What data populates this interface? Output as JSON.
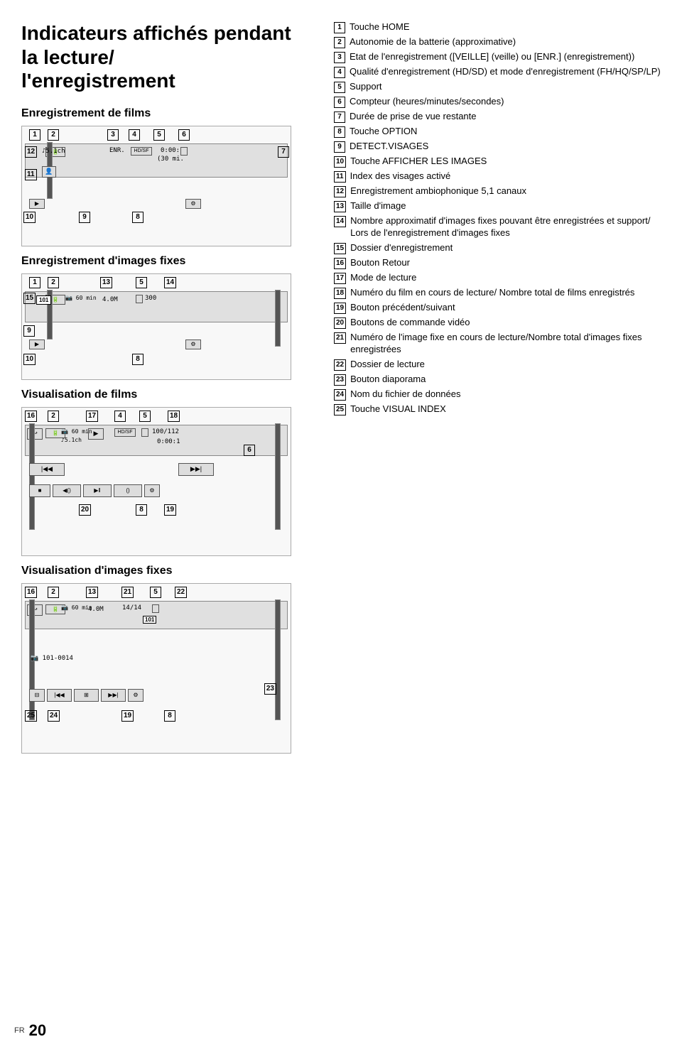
{
  "page": {
    "title_line1": "Indicateurs affichés pendant la lecture/",
    "title_line2": "l'enregistrement",
    "footer_lang": "FR",
    "footer_page": "20"
  },
  "sections": {
    "enregistrement_films": "Enregistrement de films",
    "enregistrement_images": "Enregistrement d'images fixes",
    "visualisation_films": "Visualisation de films",
    "visualisation_images": "Visualisation d'images fixes"
  },
  "items": [
    {
      "num": "1",
      "text": "Touche HOME"
    },
    {
      "num": "2",
      "text": "Autonomie de la batterie (approximative)"
    },
    {
      "num": "3",
      "text": "Etat de l'enregistrement ([VEILLE] (veille) ou [ENR.] (enregistrement))"
    },
    {
      "num": "4",
      "text": "Qualité d'enregistrement (HD/SD) et mode d'enregistrement (FH/HQ/SP/LP)"
    },
    {
      "num": "5",
      "text": "Support"
    },
    {
      "num": "6",
      "text": "Compteur (heures/minutes/secondes)"
    },
    {
      "num": "7",
      "text": "Durée de prise de vue restante"
    },
    {
      "num": "8",
      "text": "Touche OPTION"
    },
    {
      "num": "9",
      "text": "DETECT.VISAGES"
    },
    {
      "num": "10",
      "text": "Touche AFFICHER LES IMAGES"
    },
    {
      "num": "11",
      "text": "Index des visages activé"
    },
    {
      "num": "12",
      "text": "Enregistrement ambiophonique 5,1 canaux"
    },
    {
      "num": "13",
      "text": "Taille d'image"
    },
    {
      "num": "14",
      "text": "Nombre approximatif d'images fixes pouvant être enregistrées et support/ Lors de l'enregistrement d'images fixes"
    },
    {
      "num": "15",
      "text": "Dossier d'enregistrement"
    },
    {
      "num": "16",
      "text": "Bouton Retour"
    },
    {
      "num": "17",
      "text": "Mode de lecture"
    },
    {
      "num": "18",
      "text": "Numéro du film en cours de lecture/ Nombre total de films enregistrés"
    },
    {
      "num": "19",
      "text": "Bouton précédent/suivant"
    },
    {
      "num": "20",
      "text": "Boutons de commande vidéo"
    },
    {
      "num": "21",
      "text": "Numéro de l'image fixe en cours de lecture/Nombre total d'images fixes enregistrées"
    },
    {
      "num": "22",
      "text": "Dossier de lecture"
    },
    {
      "num": "23",
      "text": "Bouton diaporama"
    },
    {
      "num": "24",
      "text": "Nom du fichier de données"
    },
    {
      "num": "25",
      "text": "Touche VISUAL INDEX"
    }
  ]
}
